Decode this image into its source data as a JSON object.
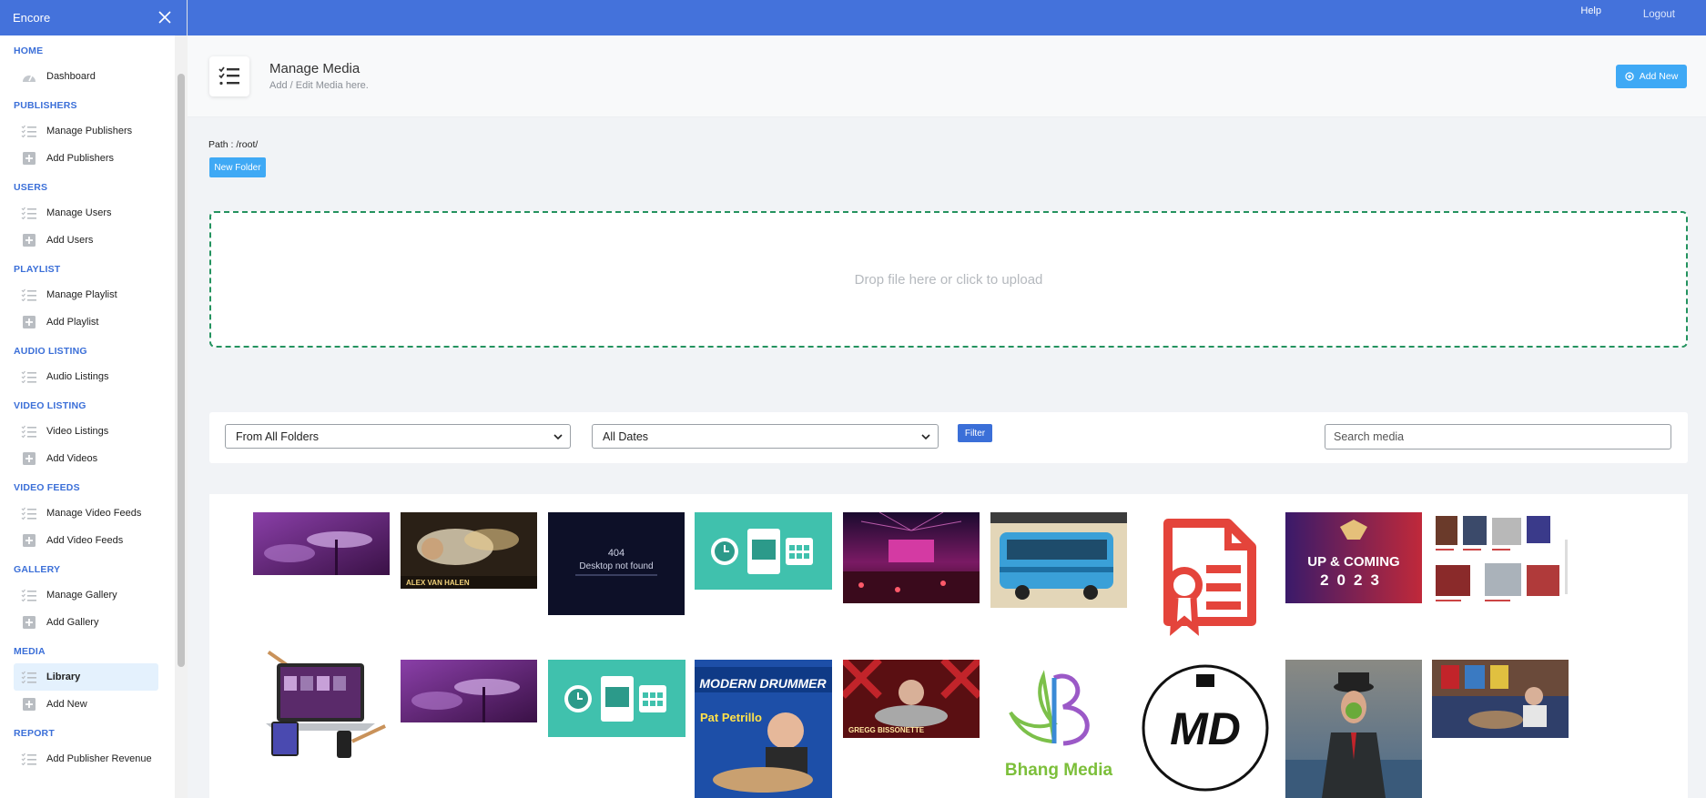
{
  "app": {
    "brand": "Encore"
  },
  "topbar": {
    "help": "Help",
    "logout": "Logout"
  },
  "sidebar": {
    "sections": [
      {
        "title": "HOME",
        "items": [
          {
            "label": "Dashboard",
            "icon": "gauge-icon"
          }
        ]
      },
      {
        "title": "PUBLISHERS",
        "items": [
          {
            "label": "Manage Publishers",
            "icon": "list-icon"
          },
          {
            "label": "Add Publishers",
            "icon": "plus-square-icon"
          }
        ]
      },
      {
        "title": "USERS",
        "items": [
          {
            "label": "Manage Users",
            "icon": "list-icon"
          },
          {
            "label": "Add Users",
            "icon": "plus-square-icon"
          }
        ]
      },
      {
        "title": "PLAYLIST",
        "items": [
          {
            "label": "Manage Playlist",
            "icon": "list-icon"
          },
          {
            "label": "Add Playlist",
            "icon": "plus-square-icon"
          }
        ]
      },
      {
        "title": "AUDIO LISTING",
        "items": [
          {
            "label": "Audio Listings",
            "icon": "list-icon"
          }
        ]
      },
      {
        "title": "VIDEO LISTING",
        "items": [
          {
            "label": "Video Listings",
            "icon": "list-icon"
          },
          {
            "label": "Add Videos",
            "icon": "plus-square-icon"
          }
        ]
      },
      {
        "title": "VIDEO FEEDS",
        "items": [
          {
            "label": "Manage Video Feeds",
            "icon": "list-icon"
          },
          {
            "label": "Add Video Feeds",
            "icon": "plus-square-icon"
          }
        ]
      },
      {
        "title": "GALLERY",
        "items": [
          {
            "label": "Manage Gallery",
            "icon": "list-icon"
          },
          {
            "label": "Add Gallery",
            "icon": "plus-square-icon"
          }
        ]
      },
      {
        "title": "MEDIA",
        "items": [
          {
            "label": "Library",
            "icon": "list-icon",
            "active": true
          },
          {
            "label": "Add New",
            "icon": "plus-square-icon"
          }
        ]
      },
      {
        "title": "REPORT",
        "items": [
          {
            "label": "Add Publisher Revenue",
            "icon": "list-icon"
          }
        ]
      }
    ]
  },
  "header": {
    "title": "Manage Media",
    "subtitle": "Add / Edit Media here.",
    "add_new": "Add New"
  },
  "path": {
    "label": "Path : /root/",
    "new_folder": "New Folder"
  },
  "dropzone": {
    "text": "Drop file here or click to upload"
  },
  "filters": {
    "folder": "From All Folders",
    "date": "All Dates",
    "filter_button": "Filter",
    "search_placeholder": "Search media"
  },
  "thumbs": {
    "desktop_404_title": "404",
    "desktop_404_sub": "Desktop not found",
    "alex": "ALEX VAN HALEN",
    "upcoming_line1": "UP & COMING",
    "upcoming_year": "2023",
    "modern_drummer": "MODERN DRUMMER",
    "pat": "Pat Petrillo",
    "gregg": "GREGG BISSONETTE",
    "bhang": "Bhang Media",
    "md": "MD"
  },
  "colors": {
    "primary": "#4472db",
    "accent": "#3fa9f5",
    "dropzone_border": "#24935f"
  }
}
